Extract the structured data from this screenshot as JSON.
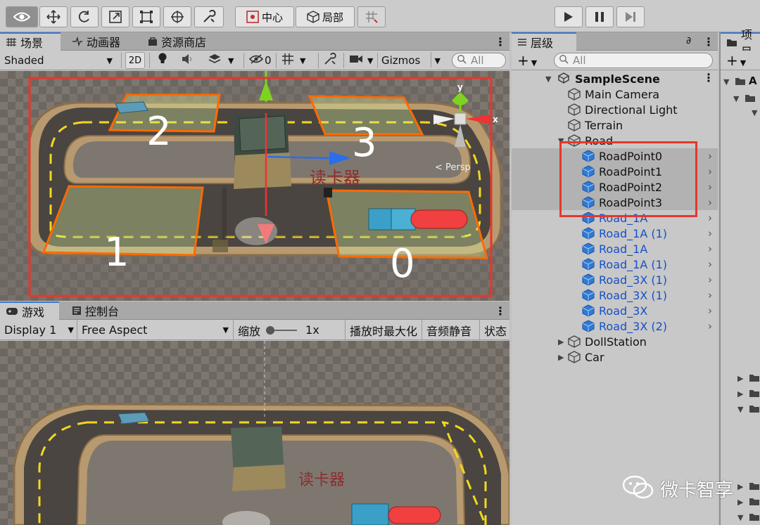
{
  "toolbar": {
    "pivot_label": "中心",
    "local_label": "局部"
  },
  "scene_tabs": {
    "scene": "场景",
    "animator": "动画器",
    "asset_store": "资源商店"
  },
  "scene_bar": {
    "shading_mode": "Shaded",
    "mode_2d": "2D",
    "hidden_count": "0",
    "gizmos": "Gizmos",
    "search_placeholder": "All"
  },
  "scene_view": {
    "slot_labels": [
      "2",
      "3",
      "1",
      "0"
    ],
    "building_label": "读卡器",
    "perspective_label": "< Persp",
    "watermark": "微卡智享",
    "gizmo_axes": {
      "y": "y",
      "x": "x"
    },
    "colors": {
      "highlight_box": "#e8362c",
      "slot_outline": "#ff6a00",
      "slot_fill": "#d8f0a0",
      "road_line": "#f2d81e",
      "gizmo_y": "#7ed321",
      "gizmo_x": "#e33",
      "gizmo_z": "#2a6ee8",
      "bus": "#f04040"
    }
  },
  "game_tabs": {
    "game": "游戏",
    "console": "控制台"
  },
  "game_bar": {
    "display": "Display 1",
    "aspect": "Free Aspect",
    "scale_label": "缩放",
    "scale_value": "1x",
    "maximize": "播放时最大化",
    "mute": "音频静音",
    "stats": "状态"
  },
  "game_view": {
    "building_label": "读卡器"
  },
  "hierarchy": {
    "tab_label": "层级",
    "lock_count": "∂",
    "search_placeholder": "All",
    "scene_name": "SampleScene",
    "items": [
      {
        "label": "Main Camera",
        "indent": 1,
        "prefab": false,
        "expand": ""
      },
      {
        "label": "Directional Light",
        "indent": 1,
        "prefab": false,
        "expand": ""
      },
      {
        "label": "Terrain",
        "indent": 1,
        "prefab": false,
        "expand": ""
      },
      {
        "label": "Road",
        "indent": 1,
        "prefab": false,
        "expand": "open"
      },
      {
        "label": "RoadPoint0",
        "indent": 2,
        "prefab": true,
        "sel": true,
        "expand": ""
      },
      {
        "label": "RoadPoint1",
        "indent": 2,
        "prefab": true,
        "sel": true,
        "expand": ""
      },
      {
        "label": "RoadPoint2",
        "indent": 2,
        "prefab": true,
        "sel": true,
        "expand": ""
      },
      {
        "label": "RoadPoint3",
        "indent": 2,
        "prefab": true,
        "sel": true,
        "expand": ""
      },
      {
        "label": "Road_1A",
        "indent": 2,
        "prefab": true,
        "blue": true,
        "expand": ""
      },
      {
        "label": "Road_1A (1)",
        "indent": 2,
        "prefab": true,
        "blue": true,
        "expand": ""
      },
      {
        "label": "Road_1A",
        "indent": 2,
        "prefab": true,
        "blue": true,
        "expand": ""
      },
      {
        "label": "Road_1A (1)",
        "indent": 2,
        "prefab": true,
        "blue": true,
        "expand": ""
      },
      {
        "label": "Road_3X (1)",
        "indent": 2,
        "prefab": true,
        "blue": true,
        "expand": ""
      },
      {
        "label": "Road_3X (1)",
        "indent": 2,
        "prefab": true,
        "blue": true,
        "expand": ""
      },
      {
        "label": "Road_3X",
        "indent": 2,
        "prefab": true,
        "blue": true,
        "expand": ""
      },
      {
        "label": "Road_3X (2)",
        "indent": 2,
        "prefab": true,
        "blue": true,
        "expand": ""
      },
      {
        "label": "DollStation",
        "indent": 1,
        "prefab": false,
        "expand": "closed"
      },
      {
        "label": "Car",
        "indent": 1,
        "prefab": false,
        "expand": "closed"
      }
    ]
  },
  "project": {
    "tab_label": "项目",
    "first_item": "A"
  }
}
